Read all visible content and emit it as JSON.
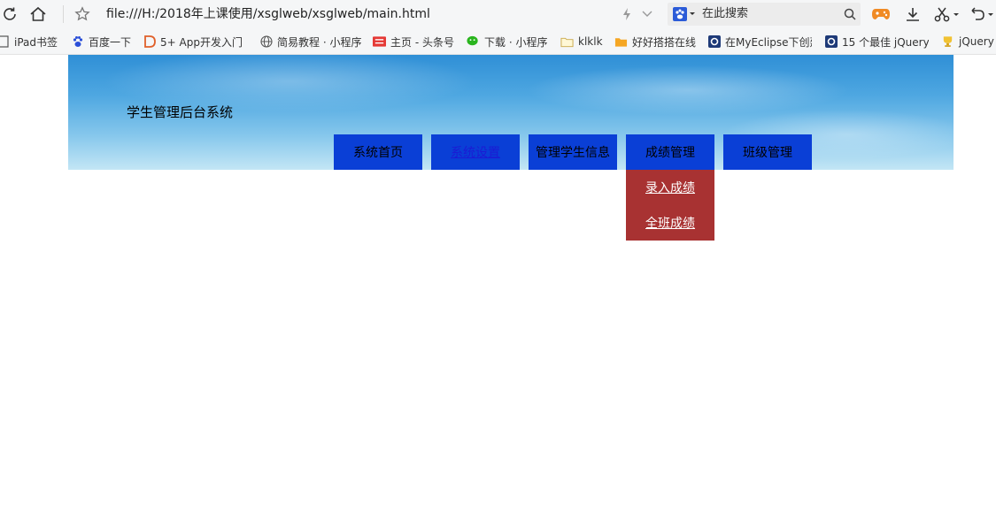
{
  "browser": {
    "url": "file:///H:/2018年上课使用/xsglweb/xsglweb/main.html",
    "search_placeholder": "在此搜索",
    "bookmarks": [
      {
        "label": "iPad书签",
        "icon": "bookmark-icon"
      },
      {
        "label": "百度一下",
        "icon": "baidu-paw-icon"
      },
      {
        "label": "5+ App开发入门",
        "icon": "dcloud-icon"
      },
      {
        "label": "简易教程 · 小程序",
        "icon": "globe-icon"
      },
      {
        "label": "主页 - 头条号",
        "icon": "toutiao-icon"
      },
      {
        "label": "下载 · 小程序",
        "icon": "wechat-icon"
      },
      {
        "label": "klklk",
        "icon": "folder-icon"
      },
      {
        "label": "好好搭搭在线",
        "icon": "folder-orange-icon"
      },
      {
        "label": "在MyEclipse下创建",
        "icon": "site-icon"
      },
      {
        "label": "15 个最佳 jQuery",
        "icon": "site-icon"
      },
      {
        "label": "jQuery",
        "icon": "trophy-icon"
      }
    ]
  },
  "page": {
    "title": "学生管理后台系统",
    "nav": [
      {
        "label": "系统首页"
      },
      {
        "label": "系统设置"
      },
      {
        "label": "管理学生信息"
      },
      {
        "label": "成绩管理"
      },
      {
        "label": "班级管理"
      }
    ],
    "dropdown": [
      {
        "label": "录入成绩"
      },
      {
        "label": "全班成绩"
      }
    ]
  },
  "colors": {
    "nav_bg": "#0a3fd6",
    "dropdown_bg": "#a83232",
    "link": "#1b1bd4"
  }
}
